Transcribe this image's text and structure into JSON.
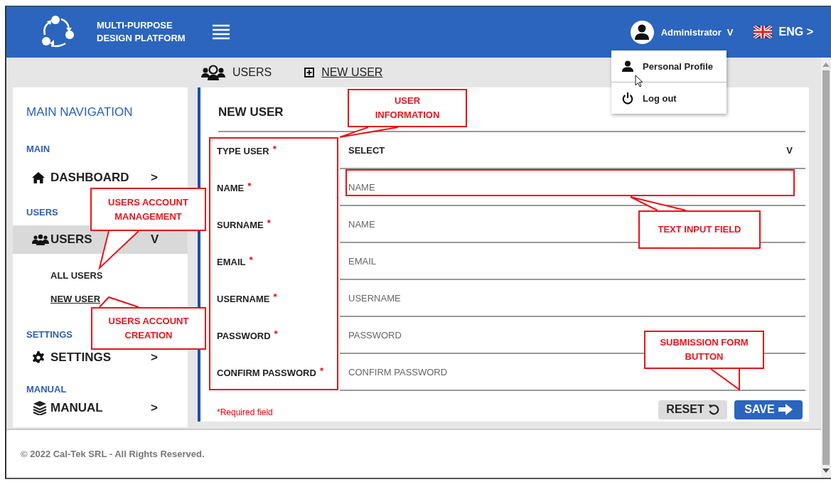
{
  "header": {
    "title_lines": [
      "MULTI-PURPOSE",
      "DESIGN PLATFORM"
    ],
    "user": "Administrator",
    "user_caret": "V",
    "language": "ENG >"
  },
  "user_menu": {
    "items": [
      {
        "label": "Personal Profile",
        "kind": "profile"
      },
      {
        "label": "Log out",
        "kind": "logout"
      }
    ]
  },
  "breadcrumb": [
    {
      "label": "USERS",
      "kind": "users",
      "link": false
    },
    {
      "label": "NEW USER",
      "kind": "add",
      "link": true
    }
  ],
  "sidebar": {
    "title": "MAIN NAVIGATION",
    "sections": [
      {
        "heading": "MAIN",
        "items": [
          {
            "label": "DASHBOARD",
            "chevron": ">",
            "expanded": false
          }
        ]
      },
      {
        "heading": "USERS",
        "items": [
          {
            "label": "USERS",
            "chevron": "V",
            "expanded": true,
            "children": [
              {
                "label": "ALL USERS",
                "selected": false
              },
              {
                "label": "NEW USER",
                "selected": true
              }
            ]
          }
        ]
      },
      {
        "heading": "SETTINGS",
        "items": [
          {
            "label": "SETTINGS",
            "chevron": ">",
            "expanded": false
          }
        ]
      },
      {
        "heading": "MANUAL",
        "items": [
          {
            "label": "MANUAL",
            "chevron": ">",
            "expanded": false
          }
        ]
      }
    ]
  },
  "form": {
    "title": "NEW USER",
    "fields": [
      {
        "label": "TYPE USER",
        "required_mark": "*",
        "kind": "select",
        "value": "SELECT",
        "caret": "V"
      },
      {
        "label": "NAME",
        "required_mark": "*",
        "kind": "text",
        "placeholder": "NAME"
      },
      {
        "label": "SURNAME",
        "required_mark": "*",
        "kind": "text",
        "placeholder": "NAME"
      },
      {
        "label": "EMAIL",
        "required_mark": "*",
        "kind": "text",
        "placeholder": "EMAIL"
      },
      {
        "label": "USERNAME",
        "required_mark": "*",
        "kind": "text",
        "placeholder": "USERNAME"
      },
      {
        "label": "PASSWORD",
        "required_mark": "*",
        "kind": "password",
        "placeholder": "PASSWORD"
      },
      {
        "label": "CONFIRM PASSWORD",
        "required_mark": "*",
        "kind": "password",
        "placeholder": "CONFIRM PASSWORD"
      }
    ],
    "note": "*Required field",
    "buttons": [
      {
        "label": "RESET",
        "kind": "reset"
      },
      {
        "label": "SAVE",
        "kind": "save"
      }
    ]
  },
  "footer": "© 2022 Cal-Tek SRL - All Rights Reserved.",
  "annotations": [
    {
      "kind": "frame"
    },
    {
      "kind": "frame"
    },
    {
      "kind": "callout",
      "lines": [
        "USER",
        "INFORMATION"
      ]
    },
    {
      "kind": "callout",
      "lines": [
        "USERS ACCOUNT",
        "MANAGEMENT"
      ]
    },
    {
      "kind": "callout",
      "lines": [
        "USERS ACCOUNT",
        "CREATION"
      ]
    },
    {
      "kind": "callout",
      "lines": [
        "TEXT INPUT FIELD"
      ]
    },
    {
      "kind": "callout",
      "lines": [
        "SUBMISSION FORM",
        "BUTTON"
      ]
    }
  ]
}
